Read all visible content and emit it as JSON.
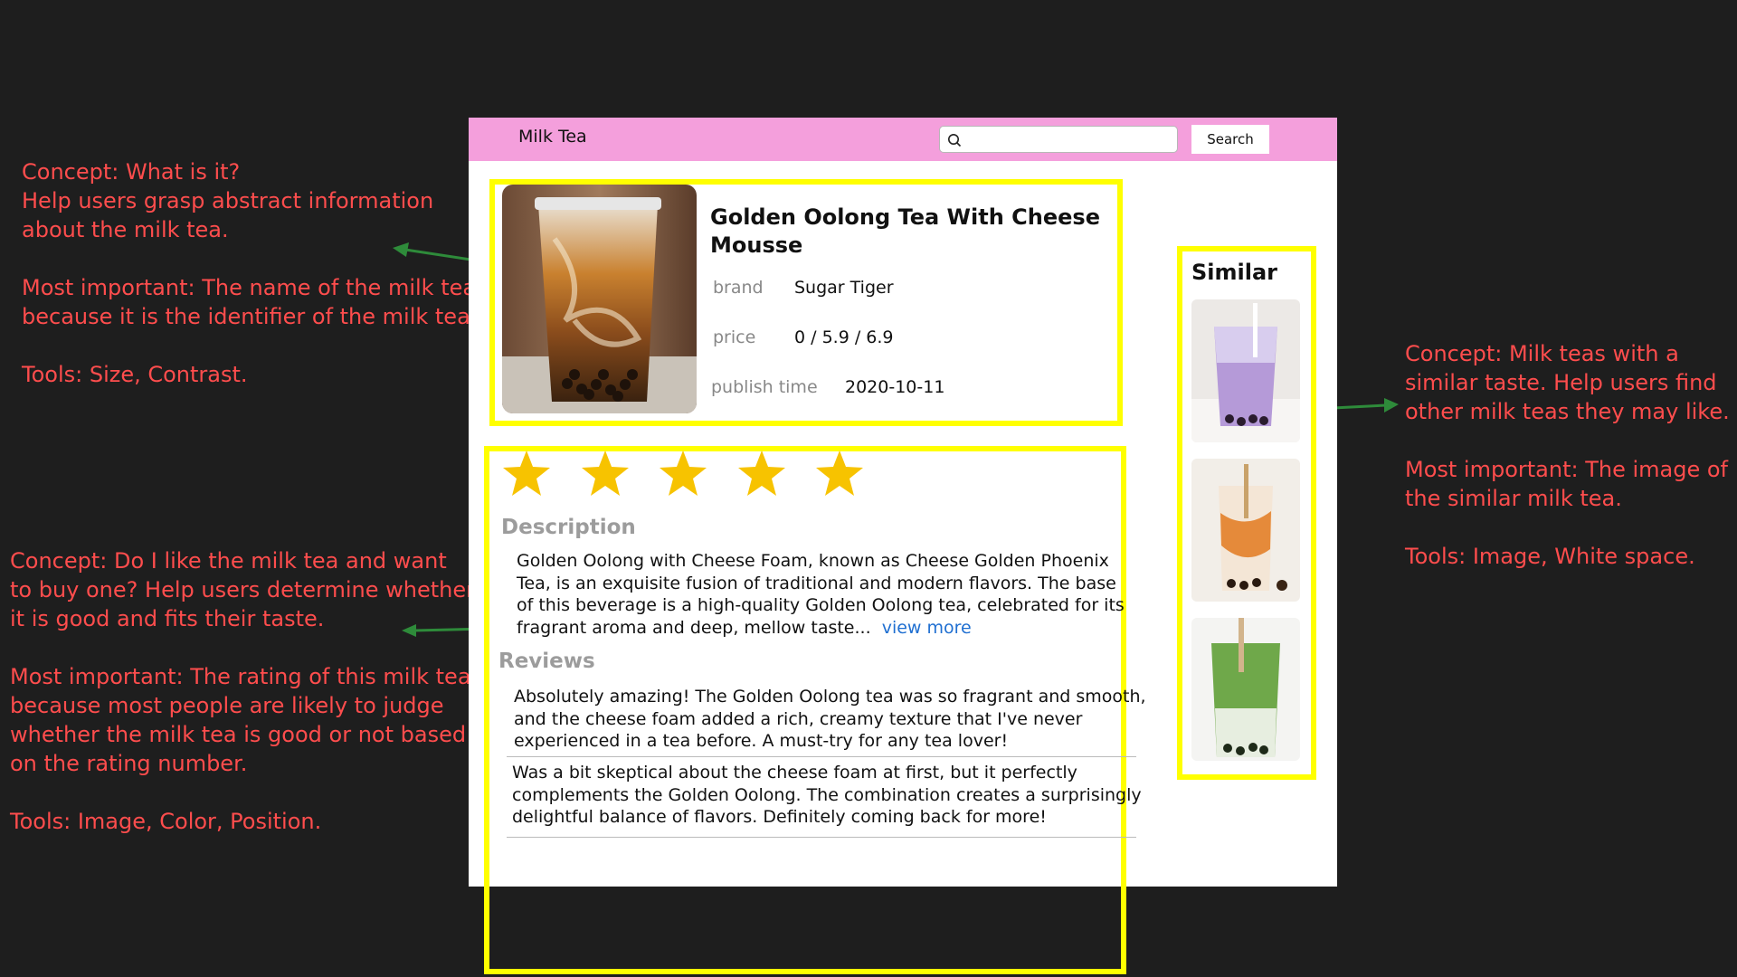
{
  "annotations": {
    "info": {
      "concept": [
        "Concept: What is it?",
        "Help users grasp abstract information",
        "about the milk tea."
      ],
      "important": [
        "Most important: The name of the milk tea",
        "because it is the identifier of the milk tea."
      ],
      "tools": "Tools: Size, Contrast."
    },
    "rating": {
      "concept": [
        "Concept: Do I like the milk tea and want",
        "to buy one? Help users determine whether",
        "it is good and fits their taste."
      ],
      "important": [
        "Most important: The rating of this milk tea",
        "because most people are likely to judge",
        "whether the milk tea is good or not based",
        "on the rating number."
      ],
      "tools": "Tools: Image, Color, Position."
    },
    "similar": {
      "concept": [
        "Concept: Milk teas with a",
        "similar taste. Help users find",
        "other milk teas they may like."
      ],
      "important": [
        "Most important: The image of",
        "the similar milk tea."
      ],
      "tools": "Tools: Image, White space."
    }
  },
  "app": {
    "title": "Milk Tea",
    "search_placeholder": "",
    "search_button": "Search"
  },
  "product": {
    "name": "Golden Oolong Tea With Cheese Mousse",
    "brand_label": "brand",
    "brand_value": "Sugar Tiger",
    "price_label": "price",
    "price_value": "0 / 5.9 / 6.9",
    "publish_label": "publish time",
    "publish_value": "2020-10-11"
  },
  "rating": {
    "stars": 5,
    "max": 5
  },
  "description": {
    "title": "Description",
    "lines": [
      "Golden Oolong with Cheese Foam, known as Cheese Golden Phoenix",
      "Tea, is  an exquisite fusion of traditional and modern flavors. The base",
      "of this  beverage is a high-quality Golden Oolong tea, celebrated for its",
      "fragrant aroma and deep, mellow taste..."
    ],
    "view_more": "view more"
  },
  "reviews": {
    "title": "Reviews",
    "items": [
      {
        "lines": [
          "Absolutely amazing! The Golden Oolong tea was so fragrant and smooth,",
          "and the cheese foam added a rich, creamy texture that I've never",
          "experienced in a tea before. A must-try for any tea lover!"
        ]
      },
      {
        "lines": [
          "Was a bit skeptical about the cheese foam at first, but it perfectly",
          "complements the Golden Oolong. The combination creates a surprisingly",
          "delightful balance of flavors. Definitely coming back for more!"
        ]
      }
    ]
  },
  "similar": {
    "title": "Similar",
    "items": [
      "taro-milk-tea-image",
      "peach-milk-tea-image",
      "matcha-milk-tea-image"
    ]
  },
  "colors": {
    "background": "#1e1e1e",
    "annotation": "#ff4d4d",
    "arrow": "#2e8b3a",
    "topbar": "#f49fdc",
    "highlight": "#ffff00",
    "star": "#f7c300",
    "link": "#1f6fd1"
  }
}
